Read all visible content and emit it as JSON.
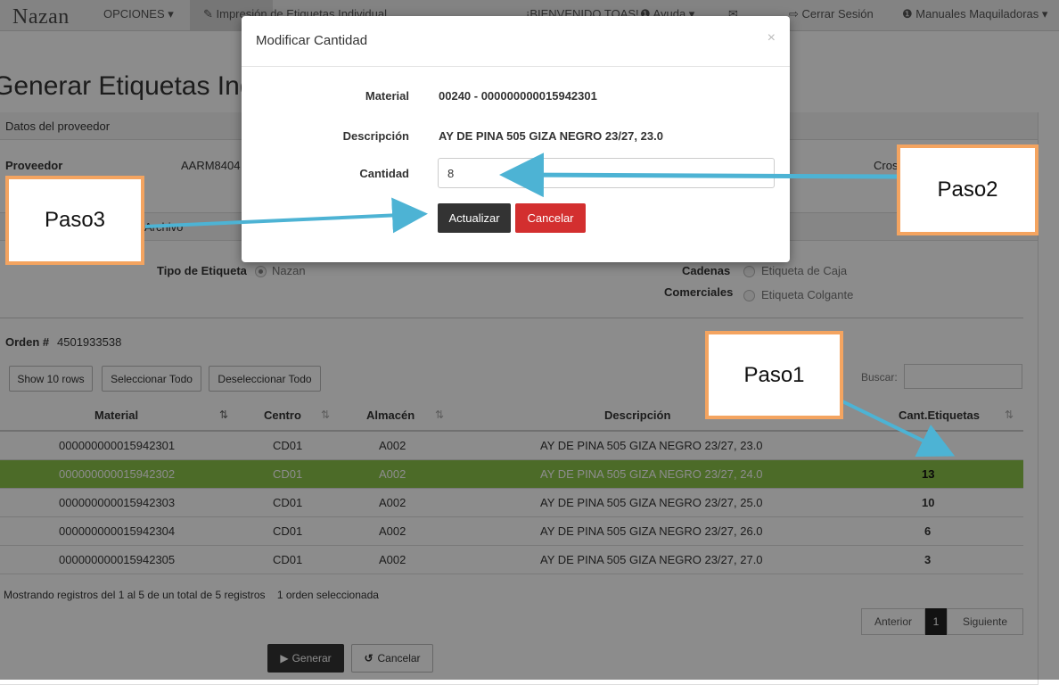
{
  "navbar": {
    "brand": "Nazan",
    "opciones": "OPCIONES ▾",
    "impresion": "✎ Impresión de Etiquetas Individual",
    "bienvenido": "¡BIENVENIDO TOAS!",
    "ayuda": "❶ Ayuda ▾",
    "cerrar": "⇨ Cerrar Sesión",
    "manuales": "❶ Manuales Maquiladoras ▾"
  },
  "page": {
    "title": "Generar Etiquetas Indiv",
    "panel_title": "Datos del proveedor",
    "proveedor_label": "Proveedor",
    "proveedor_value": "AARM8404",
    "cross_label": "Cros",
    "tab_label": "Archivo",
    "tipo_label": "Tipo de Etiqueta",
    "tipo_option": "Nazan",
    "cadenas_label": "Cadenas",
    "comerciales_label": "Comerciales",
    "opt_caja": "Etiqueta de Caja",
    "opt_colgante": "Etiqueta Colgante",
    "orden_label": "Orden #",
    "orden_value": "4501933538"
  },
  "toolbar": {
    "show_rows": "Show 10 rows",
    "select_all": "Seleccionar Todo",
    "deselect_all": "Deseleccionar Todo",
    "search_label": "Buscar:"
  },
  "table": {
    "headers": [
      "Material",
      "Centro",
      "Almacén",
      "Descripción",
      "Cant.Etiquetas"
    ],
    "rows": [
      {
        "material": "000000000015942301",
        "centro": "CD01",
        "almacen": "A002",
        "descripcion": "AY DE PINA 505 GIZA NEGRO 23/27, 23.0",
        "cantidad": ""
      },
      {
        "material": "000000000015942302",
        "centro": "CD01",
        "almacen": "A002",
        "descripcion": "AY DE PINA 505 GIZA NEGRO 23/27, 24.0",
        "cantidad": "13"
      },
      {
        "material": "000000000015942303",
        "centro": "CD01",
        "almacen": "A002",
        "descripcion": "AY DE PINA 505 GIZA NEGRO 23/27, 25.0",
        "cantidad": "10"
      },
      {
        "material": "000000000015942304",
        "centro": "CD01",
        "almacen": "A002",
        "descripcion": "AY DE PINA 505 GIZA NEGRO 23/27, 26.0",
        "cantidad": "6"
      },
      {
        "material": "000000000015942305",
        "centro": "CD01",
        "almacen": "A002",
        "descripcion": "AY DE PINA 505 GIZA NEGRO 23/27, 27.0",
        "cantidad": "3"
      }
    ],
    "selected_row": 1,
    "info": "Mostrando registros del 1 al 5 de un total de 5 registros    1 orden seleccionada"
  },
  "pagination": {
    "prev": "Anterior",
    "current": "1",
    "next": "Siguiente"
  },
  "actions": {
    "generar": "Generar",
    "cancelar": "Cancelar"
  },
  "modal": {
    "title": "Modificar Cantidad",
    "close": "×",
    "material_label": "Material",
    "material_value": "00240 - 000000000015942301",
    "descripcion_label": "Descripción",
    "descripcion_value": "AY DE PINA 505 GIZA NEGRO 23/27, 23.0",
    "cantidad_label": "Cantidad",
    "cantidad_value": "8",
    "update_button": "Actualizar",
    "cancel_button": "Cancelar"
  },
  "callouts": {
    "paso1": "Paso1",
    "paso2": "Paso2",
    "paso3": "Paso3"
  },
  "colors": {
    "selected_row": "#8bc34a",
    "update_button": "#333333",
    "cancel_button": "#d32f2f",
    "callout_border": "#f4a460",
    "arrow": "#4db3d4"
  }
}
